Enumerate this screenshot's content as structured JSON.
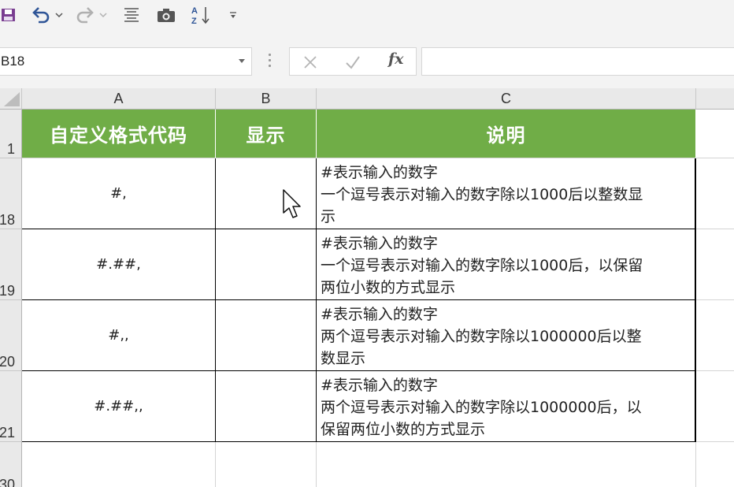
{
  "toolbar": {
    "icons": [
      "save-icon",
      "undo-icon",
      "undo-dropdown-icon",
      "redo-icon",
      "redo-dropdown-icon",
      "center-align-icon",
      "camera-icon",
      "sort-az-icon",
      "customize-qat-icon"
    ],
    "sort_label_top": "A",
    "sort_label_bottom": "Z"
  },
  "formula_bar": {
    "name_box": "B18",
    "cancel_icon": "x-icon",
    "enter_icon": "check-icon",
    "fx_label": "fx",
    "formula": ""
  },
  "columns": [
    "A",
    "B",
    "C"
  ],
  "rows": [
    {
      "num": "1",
      "a": "自定义格式代码",
      "b": "显示",
      "c": "说明",
      "header": true
    },
    {
      "num": "18",
      "a": "#,",
      "b": "",
      "c": "#表示输入的数字\n一个逗号表示对输入的数字除以1000后以整数显\n示"
    },
    {
      "num": "19",
      "a": "#.##,",
      "b": "",
      "c": "#表示输入的数字\n一个逗号表示对输入的数字除以1000后，以保留\n两位小数的方式显示"
    },
    {
      "num": "20",
      "a": "#,,",
      "b": "",
      "c": "#表示输入的数字\n两个逗号表示对输入的数字除以1000000后以整\n数显示"
    },
    {
      "num": "21",
      "a": "#.##,,",
      "b": "",
      "c": "#表示输入的数字\n两个逗号表示对输入的数字除以1000000后，以\n保留两位小数的方式显示"
    },
    {
      "num": "30",
      "a": "",
      "b": "",
      "c": ""
    }
  ],
  "colors": {
    "header_fill": "#70ad47",
    "header_text": "#ffffff",
    "accent_blue": "#2f5597",
    "save_purple": "#7a3e91"
  },
  "cursor": "mouse-pointer-icon"
}
